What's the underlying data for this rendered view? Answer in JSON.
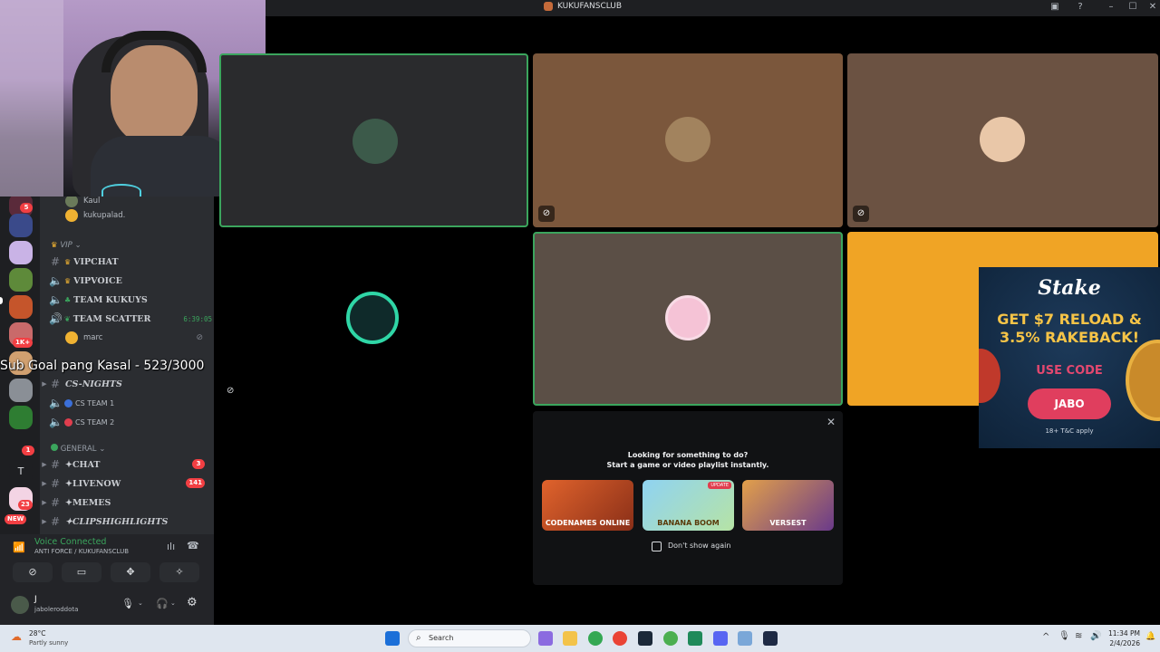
{
  "window": {
    "title": "KUKUFANSCLUB"
  },
  "overlay": {
    "subgoal": "Sub Goal pang Kasal - 523/3000"
  },
  "servers": {
    "badges": [
      "5",
      "1K+",
      "1",
      "23",
      "NEW"
    ],
    "letter": "T"
  },
  "channels": {
    "top_users": [
      "Kaul",
      "kukupalad."
    ],
    "vip_category": "VIP",
    "vip_channels": [
      "VIPCHAT",
      "VIPVOICE",
      "TEAM KUKUYS",
      "TEAM SCATTER"
    ],
    "scatter_timer": "6:39:05",
    "scatter_user": "marc",
    "cs_channel": "CS-NIGHTS",
    "cs_voice": [
      "CS TEAM 1",
      "CS TEAM 2"
    ],
    "general_category": "GENERAL",
    "general_channels": [
      {
        "label": "✦CHAT",
        "badge": "3"
      },
      {
        "label": "✦LIVENOW",
        "badge": "141"
      },
      {
        "label": "✦MEMES",
        "badge": ""
      },
      {
        "label": "✦CLIPSHIGHLIGHTS",
        "badge": ""
      }
    ]
  },
  "voice": {
    "status": "Voice Connected",
    "location": "ANTI FORCE / KUKUFANSCLUB"
  },
  "user": {
    "display": "J",
    "username": "jaboleroddota"
  },
  "activity": {
    "heading": "Looking for something to do?",
    "subheading": "Start a game or video playlist instantly.",
    "games": [
      "CODENAMES ONLINE",
      "BANANA BOOM",
      "VERSEST"
    ],
    "update_badge": "UPDATE",
    "checkbox_label": "Don't show again"
  },
  "ad": {
    "brand": "Stake",
    "headline": "GET $7 RELOAD & 3.5% RAKEBACK!",
    "code_label": "USE CODE",
    "code": "JABO",
    "disclaimer": "18+ T&C apply"
  },
  "taskbar": {
    "weather_temp": "28°C",
    "weather_desc": "Partly sunny",
    "search_placeholder": "Search",
    "time": "11:34 PM",
    "date": "2/4/2026"
  },
  "colors": {
    "speaking_border": "#3ba55d",
    "tile_brown": "#7b573c",
    "tile_tan": "#6b5242",
    "tile_grey": "#5b4f46",
    "tile_orange": "#f0a425",
    "tile_dark": "#2a2b2d"
  }
}
